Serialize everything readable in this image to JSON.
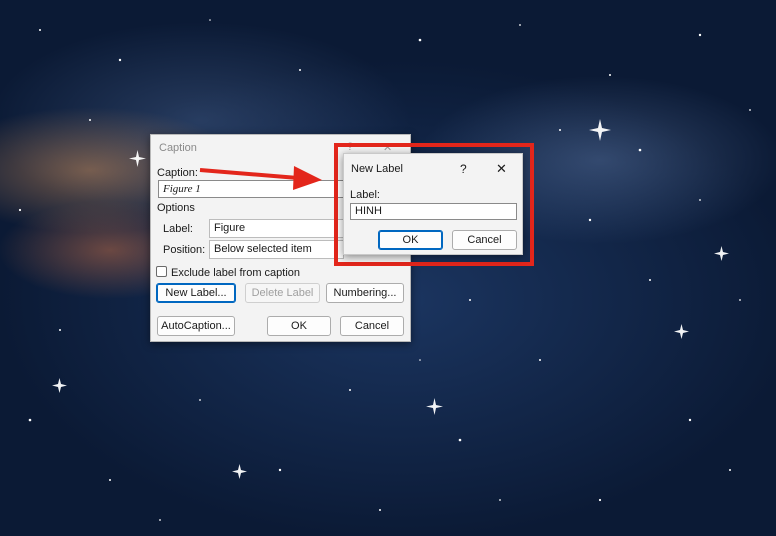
{
  "caption_dialog": {
    "title": "Caption",
    "help_glyph": "?",
    "close_glyph": "✕",
    "caption_label": "Caption:",
    "caption_value": "Figure 1",
    "options_label": "Options",
    "label_label": "Label:",
    "label_value": "Figure",
    "position_label": "Position:",
    "position_value": "Below selected item",
    "exclude_checkbox_label": "Exclude label from caption",
    "exclude_checked": false,
    "new_label_button": "New Label...",
    "delete_label_button": "Delete Label",
    "numbering_button": "Numbering...",
    "autocaption_button": "AutoCaption...",
    "ok_button": "OK",
    "cancel_button": "Cancel"
  },
  "new_label_dialog": {
    "title": "New Label",
    "help_glyph": "?",
    "close_glyph": "✕",
    "label_label": "Label:",
    "label_value": "HINH",
    "ok_button": "OK",
    "cancel_button": "Cancel"
  },
  "annotations": {
    "highlight_color": "#e3261b",
    "arrow_color": "#e3261b"
  },
  "colors": {
    "dialog_bg": "#f3f3f3",
    "accent": "#0067c0"
  }
}
